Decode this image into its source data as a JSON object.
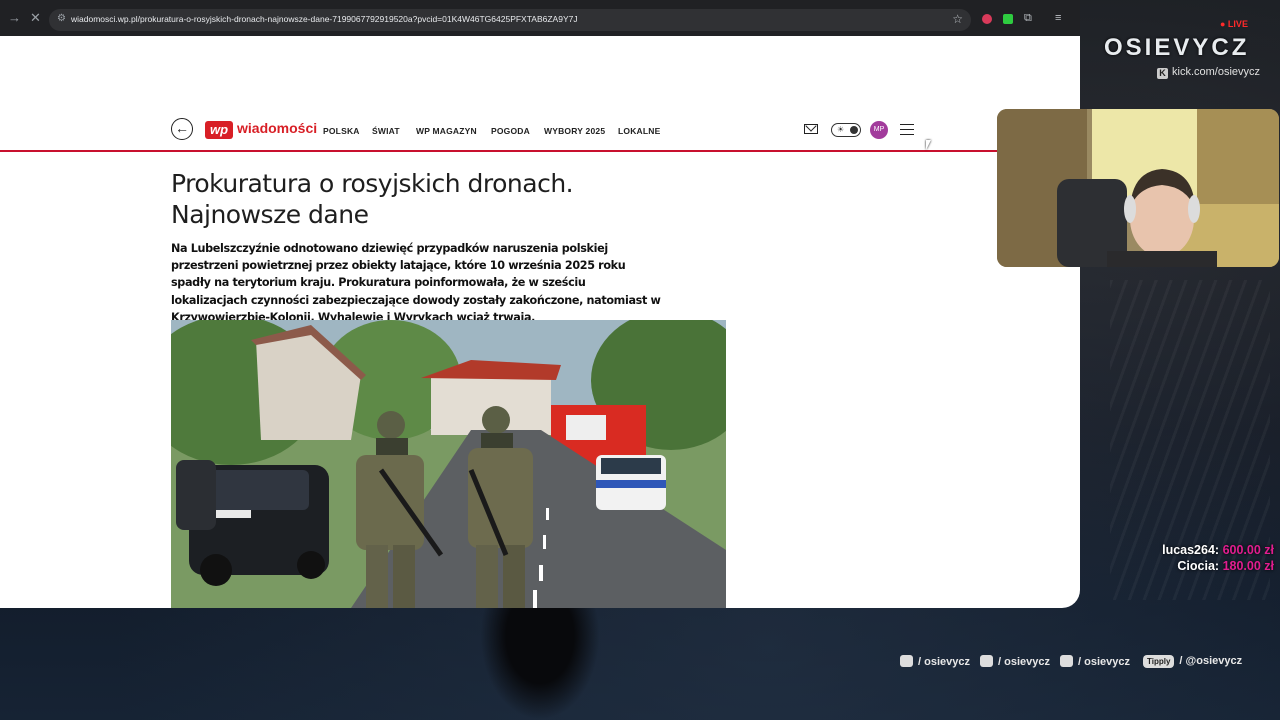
{
  "browser": {
    "url": "wiadomosci.wp.pl/prokuratura-o-rosyjskich-dronach-najnowsze-dane-7199067792919520a?pvcid=01K4W46TG6425PFXTAB6ZA9Y7J",
    "nav_forward_icon": "arrow-right-icon",
    "stop_icon": "close-icon"
  },
  "site": {
    "logo_mark": "wp",
    "logo_name": "wiadomości",
    "nav": [
      "POLSKA",
      "ŚWIAT",
      "WP MAGAZYN",
      "POGODA",
      "WYBORY 2025",
      "LOKALNE"
    ],
    "avatar_initials": "MP",
    "accent_color": "#d81f26"
  },
  "article": {
    "title_line1": "Prokuratura o rosyjskich dronach.",
    "title_line2": "Najnowsze dane",
    "lead": "Na Lubelszczyźnie odnotowano dziewięć przypadków naruszenia polskiej przestrzeni powietrznej przez obiekty latające, które 10 września 2025 roku spadły na terytorium kraju. Prokuratura poinformowała, że w sześciu lokalizacjach czynności zabezpieczające dowody zostały zakończone, natomiast w Krzywowierzbie-Kolonii, Wyhalewie i Wyrykach wciąż trwają."
  },
  "overlay": {
    "live": "● LIVE",
    "brand": "OSIEVYCZ",
    "kick": "kick.com/osievycz",
    "donations": [
      {
        "name": "lucas264:",
        "amount": "600.00 zł"
      },
      {
        "name": "Ciocia:",
        "amount": "180.00 zł"
      }
    ],
    "socials": [
      {
        "icon": "instagram-icon",
        "handle": "/ osievycz"
      },
      {
        "icon": "tiktok-icon",
        "handle": "/ osievycz"
      },
      {
        "icon": "youtube-icon",
        "handle": "/ osievycz"
      },
      {
        "icon": "tipply-icon",
        "label": "Tipply",
        "handle": "/ @osievycz"
      }
    ]
  }
}
